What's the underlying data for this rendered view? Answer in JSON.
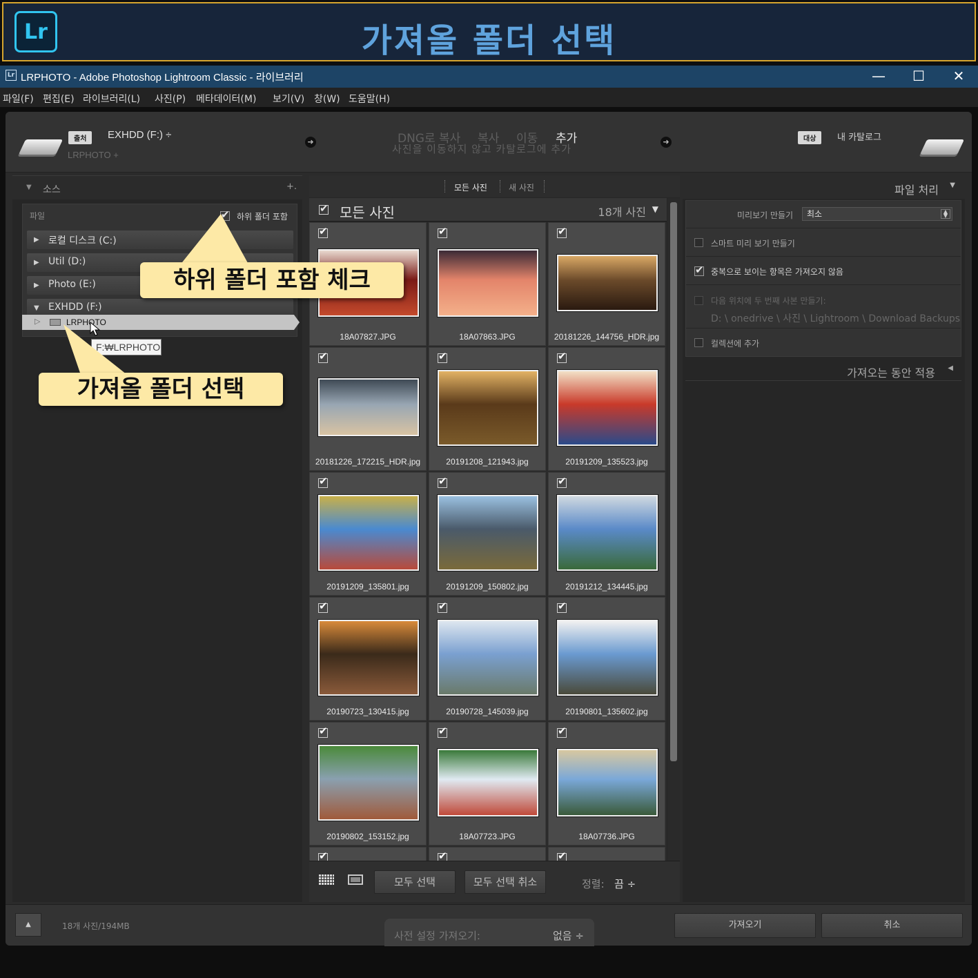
{
  "banner": {
    "logo": "Lr",
    "title": "가져올 폴더 선택"
  },
  "window": {
    "app_icon": "Lr",
    "title": "LRPHOTO - Adobe Photoshop Lightroom Classic - 라이브러리",
    "controls": {
      "minimize": "—",
      "maximize": "☐",
      "close": "✕"
    }
  },
  "menu": [
    "파일(F)",
    "편집(E)",
    "라이브러리(L)",
    "사진(P)",
    "메타데이터(M)",
    "보기(V)",
    "창(W)",
    "도움말(H)"
  ],
  "top": {
    "source_tag": "출처",
    "source_name": "EXHDD (F:) ÷",
    "source_path": "LRPHOTO +",
    "modes": [
      "DNG로 복사",
      "복사",
      "이동",
      "추가"
    ],
    "active_mode": "추가",
    "mode_desc": "사진을 이동하지 않고 카탈로그에 추가",
    "dest_tag": "대상",
    "dest_name": "내 카탈로그"
  },
  "source_panel": {
    "title": "소스",
    "add": "+.",
    "files_label": "파일",
    "include_subfolders": "하위 폴더 포함",
    "include_subfolders_checked": true,
    "drives": [
      {
        "label": "로컬 디스크 (C:)",
        "arrow": "▶"
      },
      {
        "label": "Util (D:)",
        "arrow": "▶"
      },
      {
        "label": "Photo (E:)",
        "arrow": "▶"
      },
      {
        "label": "EXHDD (F:)",
        "arrow": "▼"
      }
    ],
    "folder": {
      "arrow": "▷",
      "name": "LRPHOTO"
    },
    "tooltip": "F:₩LRPHOTO"
  },
  "callouts": {
    "subfolder": "하위 폴더 포함 체크",
    "folder": "가져올 폴더 선택"
  },
  "grid": {
    "tabs": [
      "모든 사진",
      "새 사진"
    ],
    "header_title": "모든 사진",
    "header_count": "18개 사진",
    "header_dropdown": "▼",
    "photos": [
      "18A07827.JPG",
      "18A07863.JPG",
      "20181226_144756_HDR.jpg",
      "20181226_172215_HDR.jpg",
      "20191208_121943.jpg",
      "20191209_135523.jpg",
      "20191209_135801.jpg",
      "20191209_150802.jpg",
      "20191212_134445.jpg",
      "20190723_130415.jpg",
      "20190728_145039.jpg",
      "20190801_135602.jpg",
      "20190802_153152.jpg",
      "18A07723.JPG",
      "18A07736.JPG"
    ]
  },
  "bottom_toolbar": {
    "select_all": "모두 선택",
    "deselect_all": "모두 선택 취소",
    "sort_label": "정렬:",
    "sort_value": "끔 ÷"
  },
  "file_handling": {
    "title": "파일 처리",
    "preview_label": "미리보기 만들기",
    "preview_value": "최소",
    "smart_preview": "스마트 미리 보기 만들기",
    "no_duplicates": "중복으로 보이는 항목은 가져오지 않음",
    "second_copy": "다음 위치에 두 번째 사본 만들기:",
    "second_copy_path": "D: \\ onedrive \\ 사진 \\ Lightroom \\ Download Backups",
    "add_collection": "컬렉션에 추가",
    "apply_during_import": "가져오는 동안 적용"
  },
  "footer": {
    "up": "▲",
    "summary": "18개 사진/194MB",
    "preset_label": "사전 설정 가져오기:",
    "preset_value": "없음 ÷",
    "import": "가져오기",
    "cancel": "취소"
  }
}
